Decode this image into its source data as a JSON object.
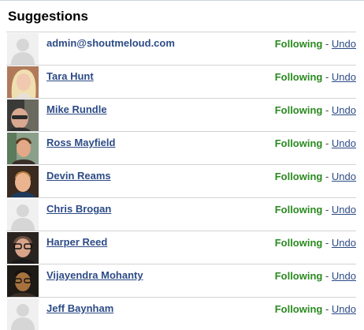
{
  "panel": {
    "title": "Suggestions"
  },
  "rows": [
    {
      "name": "admin@shoutmeloud.com",
      "status": "Following",
      "sep": " - ",
      "action": "Undo",
      "avatar": "default-avatar",
      "linked": false
    },
    {
      "name": "Tara Hunt",
      "status": "Following",
      "sep": " - ",
      "action": "Undo",
      "avatar": "profile-photo",
      "linked": true
    },
    {
      "name": "Mike Rundle",
      "status": "Following",
      "sep": " - ",
      "action": "Undo",
      "avatar": "profile-photo",
      "linked": true
    },
    {
      "name": "Ross Mayfield",
      "status": "Following",
      "sep": " - ",
      "action": "Undo",
      "avatar": "profile-photo",
      "linked": true
    },
    {
      "name": "Devin Reams",
      "status": "Following",
      "sep": " - ",
      "action": "Undo",
      "avatar": "profile-photo",
      "linked": true
    },
    {
      "name": "Chris Brogan",
      "status": "Following",
      "sep": " - ",
      "action": "Undo",
      "avatar": "default-avatar",
      "linked": true
    },
    {
      "name": "Harper Reed",
      "status": "Following",
      "sep": " - ",
      "action": "Undo",
      "avatar": "profile-photo",
      "linked": true
    },
    {
      "name": "Vijayendra Mohanty",
      "status": "Following",
      "sep": " - ",
      "action": "Undo",
      "avatar": "profile-photo",
      "linked": true
    },
    {
      "name": "Jeff Baynham",
      "status": "Following",
      "sep": " - ",
      "action": "Undo",
      "avatar": "default-avatar",
      "linked": true
    }
  ],
  "colors": {
    "link": "#2d4b86",
    "following": "#2a8a1f",
    "divider": "#d3d3d3"
  }
}
